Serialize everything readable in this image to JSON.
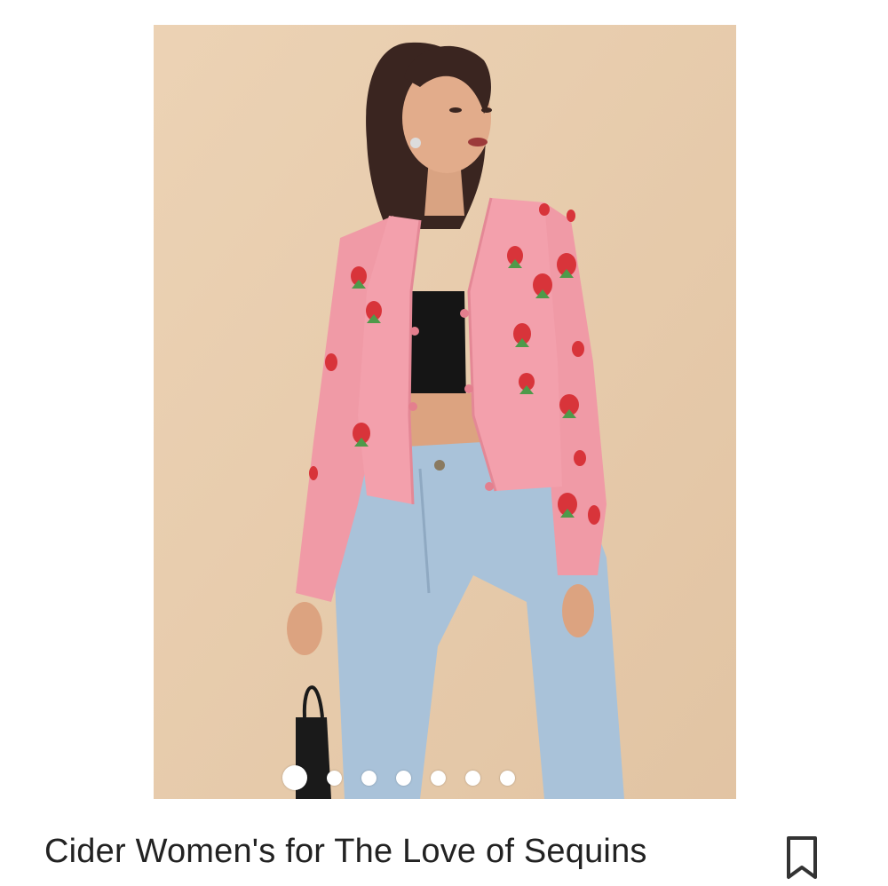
{
  "product": {
    "title": "Cider Women's for The Love of Sequins",
    "image_alt": "Model wearing pink strawberry sequin cardigan with light blue jeans"
  },
  "carousel": {
    "total_slides": 7,
    "active_index": 0
  },
  "actions": {
    "bookmark_icon": "bookmark-icon"
  },
  "colors": {
    "background": "#ffffff",
    "image_backdrop": "#e9cfb0",
    "cardigan": "#f09aa6",
    "strawberry": "#d8343a",
    "leaf": "#4e9a4a",
    "jeans": "#a9c2d9",
    "text": "#222222"
  }
}
